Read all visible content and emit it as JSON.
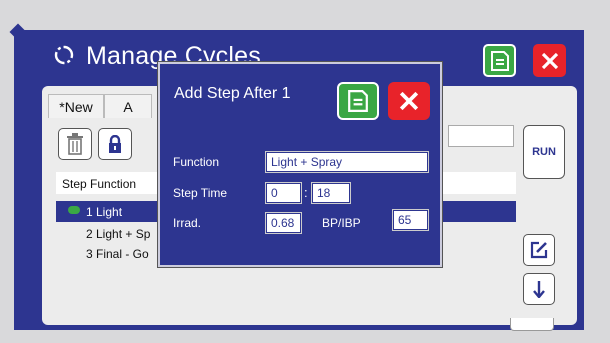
{
  "window": {
    "title": "Manage Cycles"
  },
  "tabs": [
    {
      "label": "*New"
    },
    {
      "label": "A"
    }
  ],
  "list": {
    "header": "Step Function",
    "rows": [
      {
        "label": "1 Light",
        "selected": true
      },
      {
        "label": "2 Light + Sp",
        "selected": false
      },
      {
        "label": "3 Final - Go",
        "selected": false
      }
    ]
  },
  "buttons": {
    "run": "RUN"
  },
  "dialog": {
    "title": "Add Step After 1",
    "function_label": "Function",
    "function_value": "Light + Spray",
    "step_time_label": "Step Time",
    "step_time_min": "0",
    "step_time_separator": ":",
    "step_time_sec": "18",
    "irrad_label": "Irrad.",
    "irrad_value": "0.68",
    "bp_label": "BP/IBP",
    "bp_value": "65"
  },
  "icons": {
    "title": "refresh-icon",
    "save": "save-icon",
    "close": "close-icon",
    "trash": "trash-icon",
    "lock": "lock-icon",
    "edit": "edit-icon",
    "down": "arrow-down-icon"
  },
  "colors": {
    "panel": "#2d3590",
    "save": "#3aa744",
    "close": "#e8232a",
    "background": "#ececec"
  }
}
